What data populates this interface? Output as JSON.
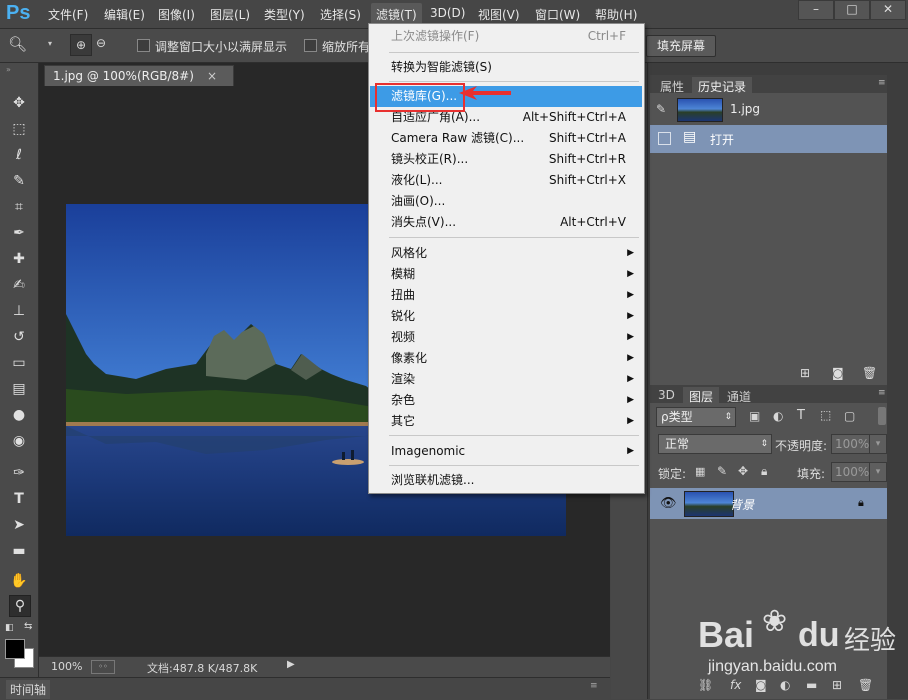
{
  "app": {
    "logo": "Ps"
  },
  "menubar": {
    "items": [
      "文件(F)",
      "编辑(E)",
      "图像(I)",
      "图层(L)",
      "类型(Y)",
      "选择(S)",
      "滤镜(T)",
      "3D(D)",
      "视图(V)",
      "窗口(W)",
      "帮助(H)"
    ],
    "active_index": 6
  },
  "options_bar": {
    "resize_windows_label": "调整窗口大小以满屏显示",
    "zoom_all_label": "缩放所有",
    "fill_screen_label": "填充屏幕"
  },
  "document": {
    "tab_title": "1.jpg @ 100%(RGB/8#)",
    "zoom": "100%",
    "doc_size": "文档:487.8 K/487.8K"
  },
  "timeline": {
    "label": "时间轴"
  },
  "filter_menu": {
    "items": [
      {
        "label": "上次滤镜操作(F)",
        "shortcut": "Ctrl+F",
        "disabled": true
      },
      {
        "label": "转换为智能滤镜(S)",
        "shortcut": ""
      },
      {
        "label": "滤镜库(G)...",
        "shortcut": "",
        "highlighted": true
      },
      {
        "label": "自适应广角(A)...",
        "shortcut": "Alt+Shift+Ctrl+A"
      },
      {
        "label": "Camera Raw 滤镜(C)...",
        "shortcut": "Shift+Ctrl+A"
      },
      {
        "label": "镜头校正(R)...",
        "shortcut": "Shift+Ctrl+R"
      },
      {
        "label": "液化(L)...",
        "shortcut": "Shift+Ctrl+X"
      },
      {
        "label": "油画(O)...",
        "shortcut": ""
      },
      {
        "label": "消失点(V)...",
        "shortcut": "Alt+Ctrl+V"
      },
      {
        "label": "风格化",
        "submenu": true
      },
      {
        "label": "模糊",
        "submenu": true
      },
      {
        "label": "扭曲",
        "submenu": true
      },
      {
        "label": "锐化",
        "submenu": true
      },
      {
        "label": "视频",
        "submenu": true
      },
      {
        "label": "像素化",
        "submenu": true
      },
      {
        "label": "渲染",
        "submenu": true
      },
      {
        "label": "杂色",
        "submenu": true
      },
      {
        "label": "其它",
        "submenu": true
      },
      {
        "label": "Imagenomic",
        "submenu": true
      },
      {
        "label": "浏览联机滤镜..."
      }
    ]
  },
  "history_panel": {
    "tabs": [
      "属性",
      "历史记录"
    ],
    "snapshot_label": "1.jpg",
    "states": [
      "打开"
    ]
  },
  "layers_panel": {
    "tabs": [
      "3D",
      "图层",
      "通道"
    ],
    "filter_kind": "ρ类型",
    "blend_mode": "正常",
    "opacity_label": "不透明度:",
    "opacity_value": "100%",
    "lock_label": "锁定:",
    "fill_label": "填充:",
    "fill_value": "100%",
    "layers": [
      {
        "name": "背景"
      }
    ]
  },
  "watermark": {
    "brand": "Bai",
    "brand2": "经验",
    "url": "jingyan.baidu.com"
  },
  "colors": {
    "highlight": "#3d9be6",
    "annotation": "#e8302f",
    "ps_blue": "#4bb1f2"
  }
}
